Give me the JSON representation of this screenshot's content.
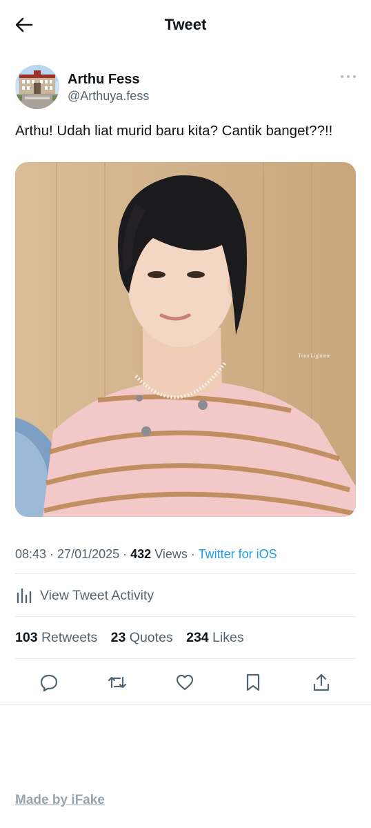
{
  "header": {
    "title": "Tweet"
  },
  "author": {
    "name": "Arthu Fess",
    "handle": "@Arthuya.fess"
  },
  "tweet": {
    "text": "Arthu! Udah liat murid baru kita? Cantik banget??!!",
    "media": {
      "watermark": "Toon Lightone"
    }
  },
  "meta": {
    "time": "08:43",
    "sep1": " · ",
    "date": "27/01/2025",
    "sep2": " · ",
    "views_count": "432",
    "views_label": " Views",
    "sep3": " · ",
    "source": "Twitter for iOS"
  },
  "activity": {
    "label": "View Tweet Activity"
  },
  "counts": {
    "retweets": {
      "value": "103",
      "label": " Retweets"
    },
    "quotes": {
      "value": "23",
      "label": " Quotes"
    },
    "likes": {
      "value": "234",
      "label": " Likes"
    }
  },
  "actions": [
    "reply-icon",
    "retweet-icon",
    "like-icon",
    "bookmark-icon",
    "share-icon"
  ],
  "footer": {
    "label": "Made by iFake"
  },
  "colors": {
    "text": "#0f1419",
    "secondary": "#536471",
    "accent": "#1d9bf0",
    "divider": "#e6ecf0"
  }
}
